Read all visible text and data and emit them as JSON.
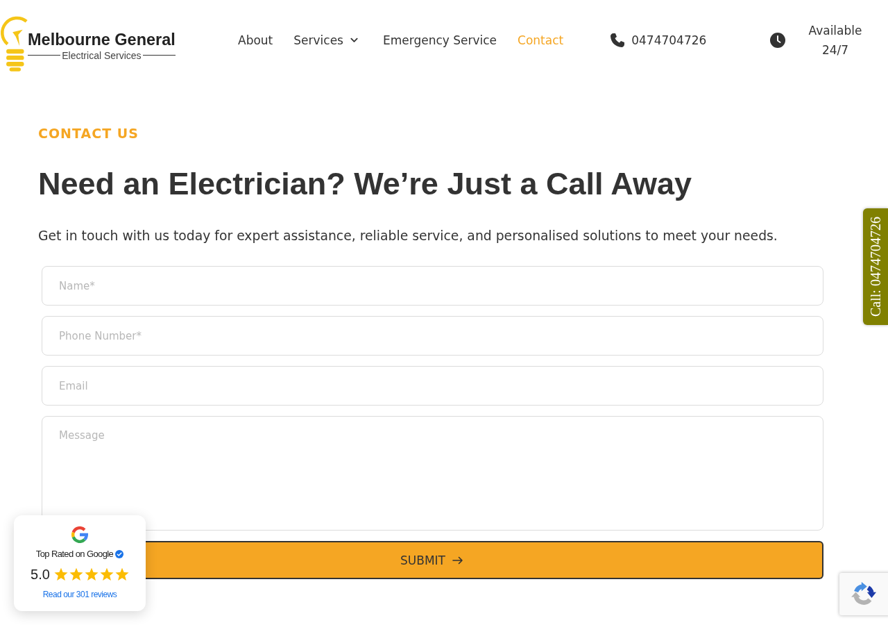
{
  "header": {
    "logo": {
      "title": "Melbourne General",
      "subtitle": "Electrical Services"
    },
    "nav": [
      {
        "label": "About",
        "selected": false,
        "has_dropdown": false
      },
      {
        "label": "Services",
        "selected": false,
        "has_dropdown": true
      },
      {
        "label": "Emergency Service",
        "selected": false,
        "has_dropdown": false
      },
      {
        "label": "Contact",
        "selected": true,
        "has_dropdown": false
      }
    ],
    "phone": "0474704726",
    "availability": "Available 24/7"
  },
  "contact": {
    "eyebrow": "CONTACT US",
    "heading": "Need an Electrician? We’re Just a Call Away",
    "intro": "Get in touch with us today for expert assistance, reliable service, and personalised solutions to meet your needs.",
    "form": {
      "fields": [
        {
          "kind": "text",
          "placeholder": "Name*"
        },
        {
          "kind": "text",
          "placeholder": "Phone Number*"
        },
        {
          "kind": "text",
          "placeholder": "Email"
        },
        {
          "kind": "textarea",
          "placeholder": "Message"
        }
      ],
      "submit": "SUBMIT"
    }
  },
  "call_tab": "Call: 0474704726",
  "google_badge": {
    "title": "Top Rated on Google",
    "rating": "5.0",
    "stars": 5,
    "link": "Read our 301 reviews"
  }
}
